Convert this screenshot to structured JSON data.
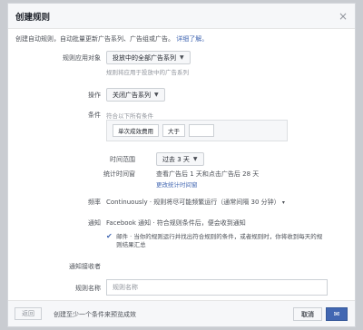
{
  "header": {
    "title": "创建规则",
    "close_glyph": "×"
  },
  "intro": {
    "text": "创建自动规则，自动批量更新广告系列、广告组或广告。",
    "link": "详细了解。"
  },
  "scope": {
    "label": "规则应用对象",
    "value": "投放中的全部广告系列",
    "hint": "规则将应用于投放中的广告系列"
  },
  "action": {
    "label": "操作",
    "value": "关闭广告系列"
  },
  "conditions": {
    "label": "条件",
    "hint": "符合以下所有条件",
    "metric": "单次成效费用",
    "operator": "大于",
    "value": ""
  },
  "time_range": {
    "label": "时间范围",
    "value": "过去 3 天"
  },
  "attribution": {
    "label": "统计时间窗",
    "line1": "查看广告后 1 天和点击广告后 28 天",
    "link": "更改统计时间窗"
  },
  "frequency": {
    "label": "频率",
    "text": "Continuously · 规则将尽可能频繁运行（通常间隔 30 分钟）"
  },
  "notify": {
    "label": "通知",
    "line1": "Facebook 通知 · 符合规则条件后，便会收到通知",
    "email": "邮件 · 当你的规则运行并找出符合规则的条件，或者规则时，你将收到每天的规则结果汇总"
  },
  "subscriber": {
    "label": "通知接收者"
  },
  "rule_name": {
    "label": "规则名称",
    "placeholder": "规则名称"
  },
  "footer": {
    "back": "返回",
    "note": "创建至少一个条件来预览成效",
    "cancel": "取消"
  }
}
